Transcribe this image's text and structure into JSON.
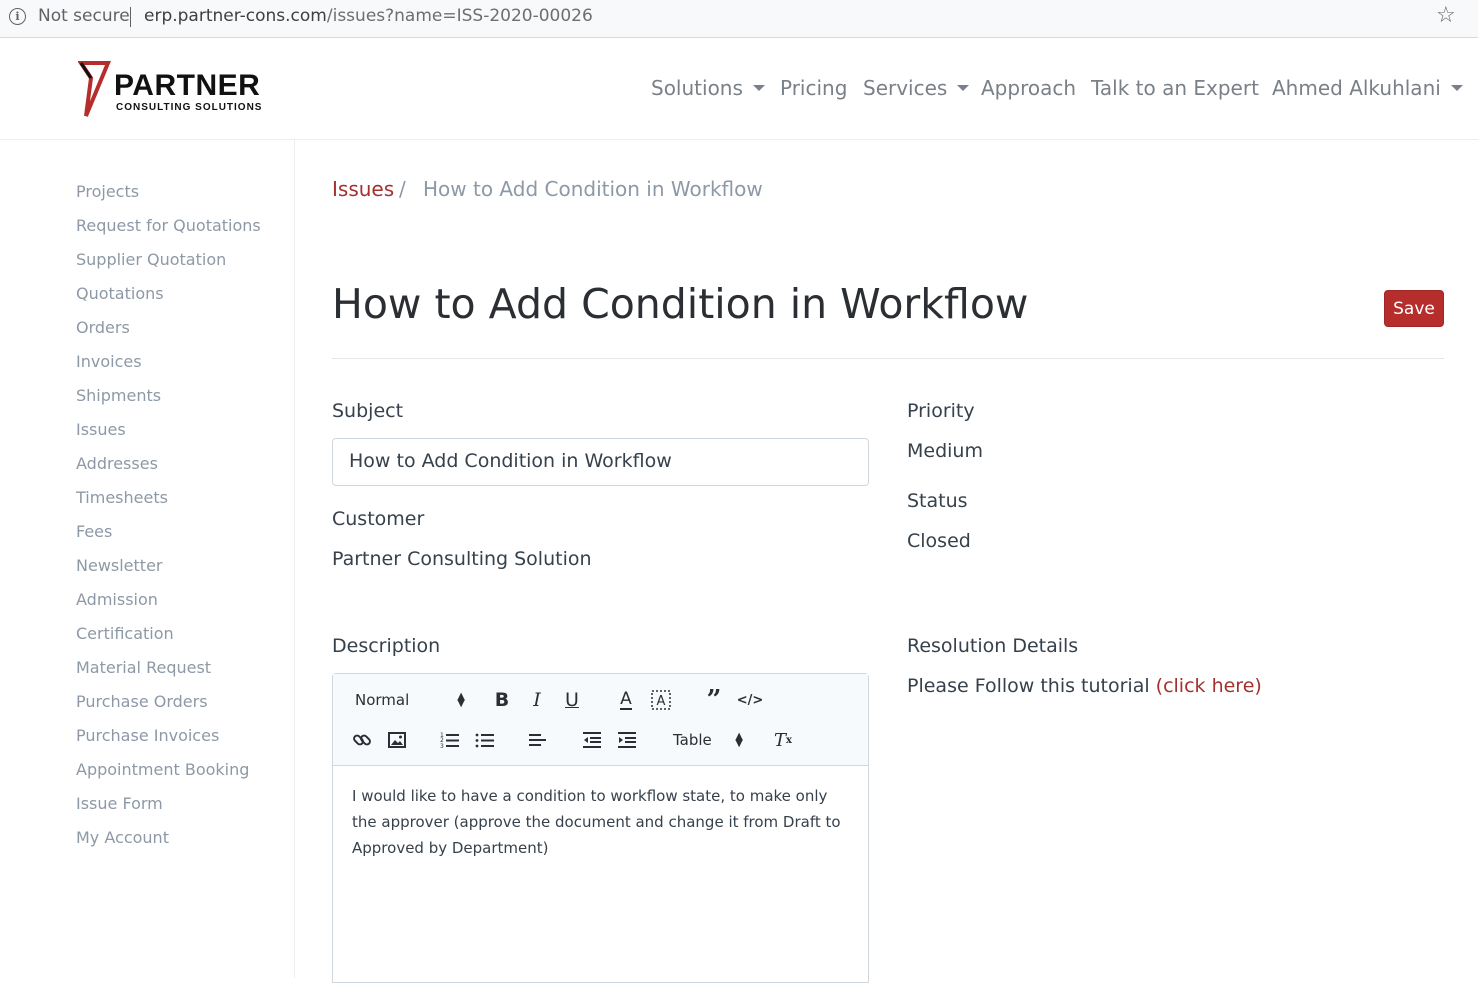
{
  "browser": {
    "security_label": "Not secure",
    "url_host": "erp.partner-cons.com",
    "url_path": "/issues?name=ISS-2020-00026"
  },
  "brand": {
    "name": "PARTNER",
    "tagline": "CONSULTING SOLUTIONS",
    "accent_color": "#b52e2b"
  },
  "nav": {
    "solutions": "Solutions",
    "pricing": "Pricing",
    "services": "Services",
    "approach": "Approach",
    "talk": "Talk to an Expert",
    "user": "Ahmed Alkuhlani"
  },
  "sidebar": {
    "items": [
      {
        "label": "Projects"
      },
      {
        "label": "Request for Quotations"
      },
      {
        "label": "Supplier Quotation"
      },
      {
        "label": "Quotations"
      },
      {
        "label": "Orders"
      },
      {
        "label": "Invoices"
      },
      {
        "label": "Shipments"
      },
      {
        "label": "Issues"
      },
      {
        "label": "Addresses"
      },
      {
        "label": "Timesheets"
      },
      {
        "label": "Fees"
      },
      {
        "label": "Newsletter"
      },
      {
        "label": "Admission"
      },
      {
        "label": "Certification"
      },
      {
        "label": "Material Request"
      },
      {
        "label": "Purchase Orders"
      },
      {
        "label": "Purchase Invoices"
      },
      {
        "label": "Appointment Booking"
      },
      {
        "label": "Issue Form"
      },
      {
        "label": "My Account"
      }
    ]
  },
  "breadcrumb": {
    "parent": "Issues",
    "separator": "/",
    "current": "How to Add Condition in Workflow"
  },
  "page": {
    "title": "How to Add Condition in Workflow",
    "save_label": "Save"
  },
  "form": {
    "subject_label": "Subject",
    "subject_value": "How to Add Condition in Workflow",
    "customer_label": "Customer",
    "customer_value": "Partner Consulting Solution",
    "priority_label": "Priority",
    "priority_value": "Medium",
    "status_label": "Status",
    "status_value": "Closed",
    "description_label": "Description",
    "resolution_label": "Resolution Details",
    "resolution_text": "Please Follow this tutorial ",
    "resolution_link": "(click here)"
  },
  "editor": {
    "format_select": "Normal",
    "table_select": "Table",
    "content": "I would like to have a condition to workflow state, to make only the approver (approve the document and change it from Draft to Approved by Department)"
  }
}
